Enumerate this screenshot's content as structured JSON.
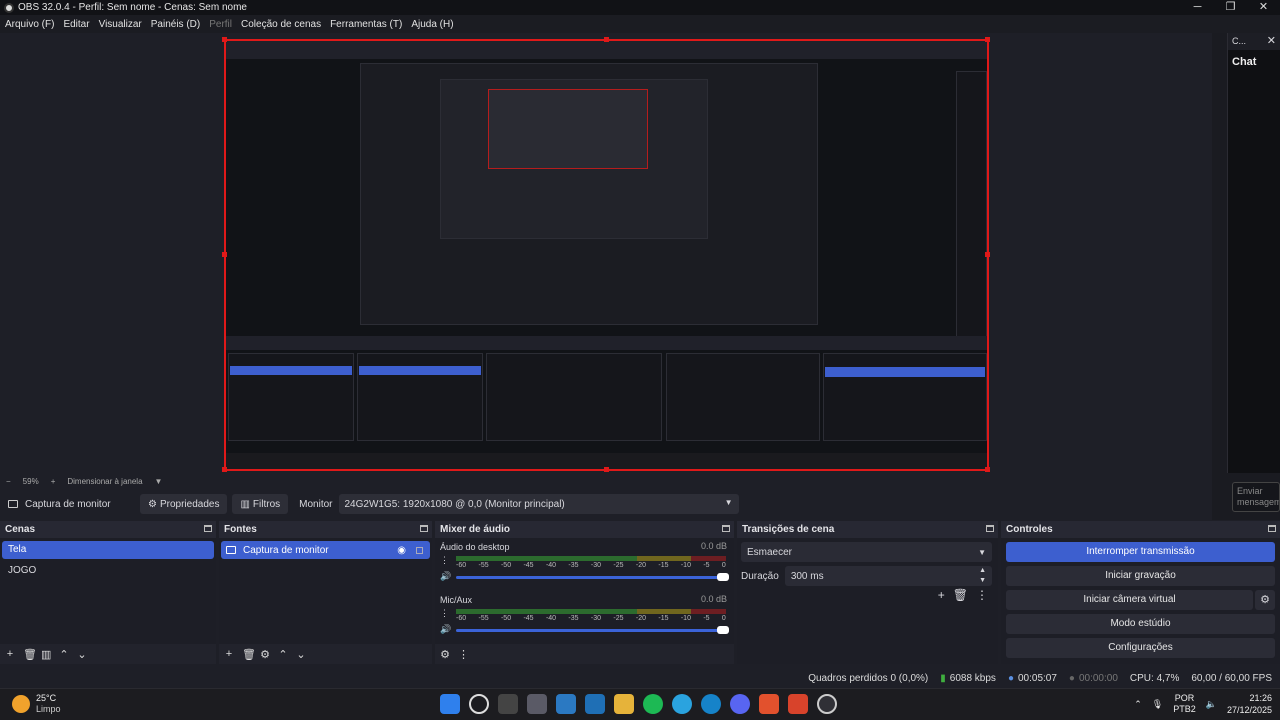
{
  "window": {
    "title": "OBS 32.0.4 - Perfil: Sem nome - Cenas: Sem nome",
    "minimize": "─",
    "maximize": "❐",
    "close": "✕"
  },
  "menu": {
    "items": [
      "Arquivo (F)",
      "Editar",
      "Visualizar",
      "Painéis (D)",
      "Perfil",
      "Coleção de cenas",
      "Ferramentas (T)",
      "Ajuda (H)"
    ]
  },
  "chat": {
    "dock_title": "C...",
    "title": "Chat",
    "input_placeholder": "Enviar mensagem"
  },
  "zoom": {
    "minus": "−",
    "level": "59%",
    "plus": "+",
    "mode": "Dimensionar à janela"
  },
  "source_toolbar": {
    "source_name": "Captura de monitor",
    "properties": "Propriedades",
    "filters": "Filtros",
    "monitor_label": "Monitor",
    "monitor_value": "24G2W1G5: 1920x1080 @ 0,0 (Monitor principal)"
  },
  "scenes": {
    "title": "Cenas",
    "items": [
      "Tela",
      "JOGO"
    ],
    "active": "Tela"
  },
  "sources": {
    "title": "Fontes",
    "items": [
      "Captura de monitor"
    ]
  },
  "mixer": {
    "title": "Mixer de áudio",
    "channels": [
      {
        "name": "Áudio do desktop",
        "db": "0.0 dB"
      },
      {
        "name": "Mic/Aux",
        "db": "0.0 dB"
      }
    ],
    "scale": [
      "-60",
      "-55",
      "-50",
      "-45",
      "-40",
      "-35",
      "-30",
      "-25",
      "-20",
      "-15",
      "-10",
      "-5",
      "0"
    ]
  },
  "transitions": {
    "title": "Transições de cena",
    "selected": "Esmaecer",
    "duration_label": "Duração",
    "duration_value": "300 ms"
  },
  "controls": {
    "title": "Controles",
    "stop_stream": "Interromper transmissão",
    "start_recording": "Iniciar gravação",
    "start_virtual_camera": "Iniciar câmera virtual",
    "studio_mode": "Modo estúdio",
    "settings": "Configurações"
  },
  "status": {
    "dropped_frames": "Quadros perdidos 0 (0,0%)",
    "bitrate": "6088 kbps",
    "stream_time": "00:05:07",
    "record_time": "00:00:00",
    "cpu": "CPU: 4,7%",
    "fps": "60,00 / 60,00 FPS"
  },
  "taskbar": {
    "temperature": "25°C",
    "condition": "Limpo",
    "lang_1": "POR",
    "lang_2": "PTB2",
    "time": "21:26",
    "date": "27/12/2025"
  },
  "colors": {
    "accent": "#3d5fcf",
    "selection_border": "#e01919",
    "meter_green": "#2c6b2e",
    "meter_yellow": "#70661e",
    "meter_red": "#6d1e22"
  }
}
